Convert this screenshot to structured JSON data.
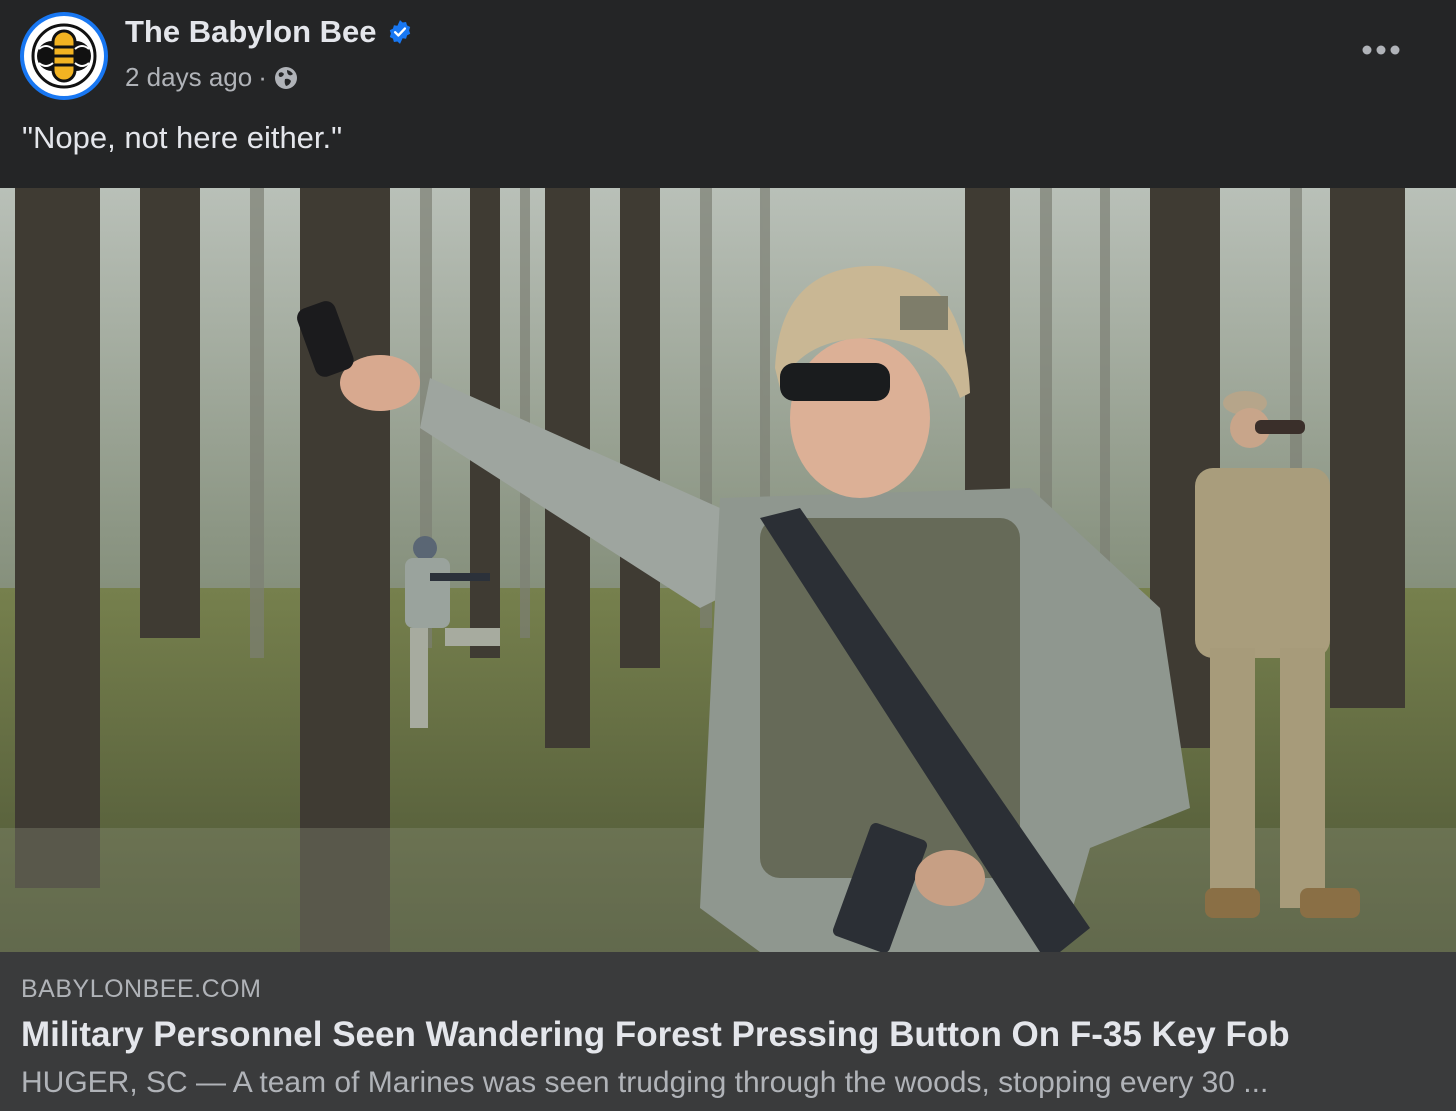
{
  "post": {
    "page_name": "The Babylon Bee",
    "timestamp": "2 days ago",
    "separator": "·",
    "caption": "\"Nope, not here either.\""
  },
  "link": {
    "domain": "BABYLONBEE.COM",
    "headline": "Military Personnel Seen Wandering Forest Pressing Button On F-35 Key Fob",
    "summary": "HUGER, SC — A team of Marines was seen trudging through the woods, stopping every 30 ..."
  },
  "colors": {
    "background": "#242526",
    "link_box": "#3a3b3c",
    "verified": "#1877f2",
    "text_primary": "#e4e6eb",
    "text_secondary": "#b0b3b8"
  },
  "icons": [
    "babylon-bee-logo",
    "verified-badge-icon",
    "globe-icon",
    "more-options-icon"
  ]
}
